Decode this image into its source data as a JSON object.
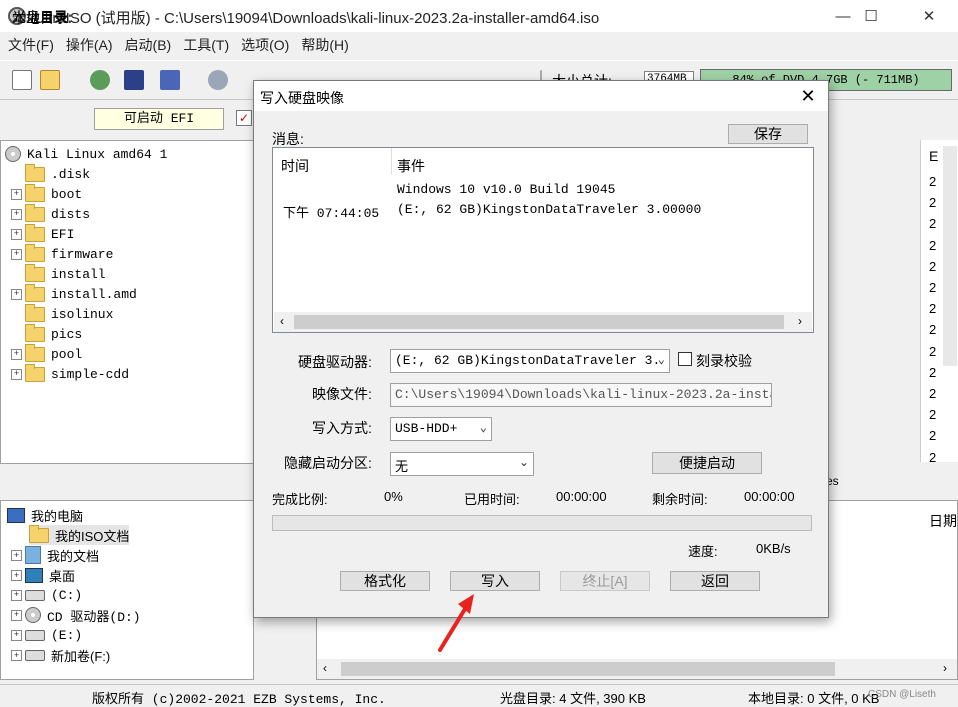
{
  "window": {
    "title": "UltraISO (试用版) - C:\\Users\\19094\\Downloads\\kali-linux-2023.2a-installer-amd64.iso",
    "minimize": "—",
    "maximize": "☐",
    "close": "✕"
  },
  "menu": [
    "文件(F)",
    "操作(A)",
    "启动(B)",
    "工具(T)",
    "选项(O)",
    "帮助(H)"
  ],
  "toolbar": {
    "size_label": "大小总计:",
    "size_total": "3764MB",
    "capacity": "84% of DVD 4.7GB (- 711MB)"
  },
  "cd_pane": {
    "label": "光盘目录:",
    "boot_field": "可启动 EFI",
    "root": "Kali Linux amd64 1",
    "items": [
      {
        "name": ".disk",
        "expandable": false
      },
      {
        "name": "boot",
        "expandable": true
      },
      {
        "name": "dists",
        "expandable": true
      },
      {
        "name": "EFI",
        "expandable": true
      },
      {
        "name": "firmware",
        "expandable": true
      },
      {
        "name": "install",
        "expandable": false
      },
      {
        "name": "install.amd",
        "expandable": true
      },
      {
        "name": "isolinux",
        "expandable": false
      },
      {
        "name": "pics",
        "expandable": false
      },
      {
        "name": "pool",
        "expandable": true
      },
      {
        "name": "simple-cdd",
        "expandable": true
      }
    ]
  },
  "local_pane": {
    "label": "本地目录:",
    "items": [
      "我的电脑",
      "我的ISO文档",
      "我的文档",
      "桌面",
      "(C:)",
      "CD 驱动器(D:)",
      "(E:)",
      "新加卷(F:)"
    ]
  },
  "right_pane": {
    "col_header_top": "E",
    "values": [
      "2",
      "2",
      "2",
      "2",
      "2",
      "2",
      "2",
      "2",
      "2",
      "2",
      "2",
      "2",
      "2",
      "2"
    ],
    "partial_text": "es",
    "col_header_bottom": "日期"
  },
  "statusbar": {
    "copyright": "版权所有 (c)2002-2021 EZB Systems, Inc.",
    "cd_dir": "光盘目录: 4 文件, 390 KB",
    "local_dir": "本地目录: 0 文件, 0 KB",
    "watermark": "CSDN @Liseth"
  },
  "dialog": {
    "title": "写入硬盘映像",
    "close": "✕",
    "message_label": "消息:",
    "save_button": "保存",
    "columns": [
      "时间",
      "事件"
    ],
    "messages": [
      {
        "time": "",
        "event": "Windows 10 v10.0 Build 19045"
      },
      {
        "time": "下午 07:44:05",
        "event": "(E:, 62 GB)KingstonDataTraveler 3.00000"
      }
    ],
    "drive_label": "硬盘驱动器:",
    "drive_value": "(E:, 62 GB)KingstonDataTraveler 3.",
    "verify_label": "刻录校验",
    "image_label": "映像文件:",
    "image_value": "C:\\Users\\19094\\Downloads\\kali-linux-2023.2a-instal",
    "method_label": "写入方式:",
    "method_value": "USB-HDD+",
    "hide_label": "隐藏启动分区:",
    "hide_value": "无",
    "quick_boot_button": "便捷启动",
    "progress_label": "完成比例:",
    "progress_value": "0%",
    "elapsed_label": "已用时间:",
    "elapsed_value": "00:00:00",
    "remaining_label": "剩余时间:",
    "remaining_value": "00:00:00",
    "progress_fraction": 0,
    "speed_label": "速度:",
    "speed_value": "0KB/s",
    "format_button": "格式化",
    "write_button": "写入",
    "abort_button": "终止[A]",
    "back_button": "返回"
  }
}
